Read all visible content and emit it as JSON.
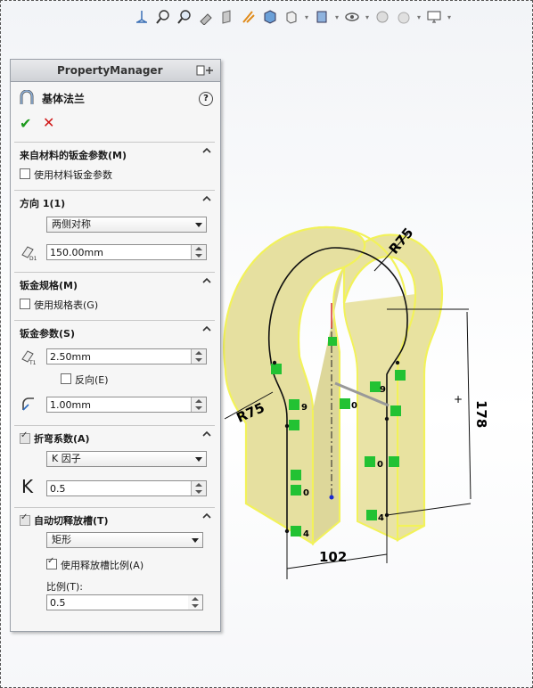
{
  "toolbar": {
    "icons": [
      "view-orientation-icon",
      "zoom-to-fit-icon",
      "zoom-area-icon",
      "previous-view-icon",
      "section-view-icon",
      "dynamic-annotation-icon",
      "view-cube-icon",
      "display-style-icon",
      "hide-show-icon",
      "edit-appearance-icon",
      "apply-scene-icon",
      "view-settings-icon"
    ]
  },
  "property_manager": {
    "title": "PropertyManager",
    "feature_name": "基体法兰",
    "help": "?",
    "ok": "✔",
    "cancel": "✕",
    "sections": {
      "material": {
        "title": "来自材料的钣金参数(M)",
        "checkbox_label": "使用材料钣金参数",
        "checked": false
      },
      "direction": {
        "title": "方向 1(1)",
        "end_condition": "两侧对称",
        "depth": "150.00mm"
      },
      "gauge": {
        "title": "钣金规格(M)",
        "checkbox_label": "使用规格表(G)",
        "checked": false
      },
      "params": {
        "title": "钣金参数(S)",
        "thickness": "2.50mm",
        "reverse_label": "反向(E)",
        "reverse_checked": false,
        "bend_radius": "1.00mm"
      },
      "allowance": {
        "title": "折弯系数(A)",
        "enabled": true,
        "type": "K 因子",
        "k_symbol": "K",
        "k_value": "0.5"
      },
      "relief": {
        "title": "自动切释放槽(T)",
        "enabled": true,
        "type": "矩形",
        "ratio_checkbox_label": "使用释放槽比例(A)",
        "ratio_checked": true,
        "ratio_label": "比例(T):",
        "ratio_value": "0.5"
      }
    }
  },
  "model": {
    "dimensions": {
      "radius_top": "R75",
      "radius_left": "R75",
      "height": "178",
      "width": "102"
    },
    "relation_labels": [
      "9",
      "9",
      "0",
      "0",
      "0",
      "4",
      "4"
    ]
  }
}
